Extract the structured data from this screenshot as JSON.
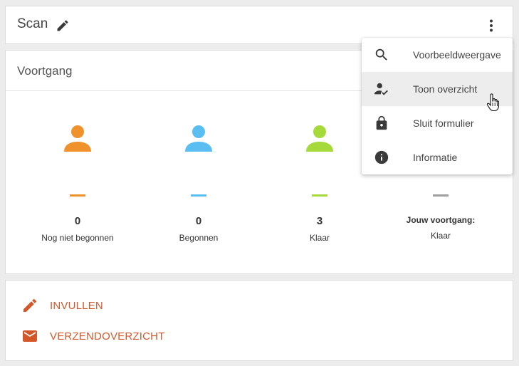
{
  "header": {
    "title": "Scan"
  },
  "progress": {
    "title": "Voortgang",
    "stats": [
      {
        "value": "0",
        "label": "Nog niet begonnen",
        "color": "#f0922b"
      },
      {
        "value": "0",
        "label": "Begonnen",
        "color": "#5bbef2"
      },
      {
        "value": "3",
        "label": "Klaar",
        "color": "#a6d93a"
      },
      {
        "label_top": "Jouw voortgang:",
        "label": "Klaar",
        "color": "#9e9e9e"
      }
    ]
  },
  "actions": [
    {
      "label": "INVULLEN",
      "icon": "pencil-icon"
    },
    {
      "label": "VERZENDOVERZICHT",
      "icon": "envelope-icon"
    }
  ],
  "menu": {
    "items": [
      {
        "label": "Voorbeeldweergave",
        "icon": "search-icon"
      },
      {
        "label": "Toon overzicht",
        "icon": "person-check-icon"
      },
      {
        "label": "Sluit formulier",
        "icon": "lock-icon"
      },
      {
        "label": "Informatie",
        "icon": "info-icon"
      }
    ]
  },
  "colors": {
    "accent": "#d4572a",
    "menu_hover": "#ededed",
    "icon": "#3a3a3a"
  }
}
